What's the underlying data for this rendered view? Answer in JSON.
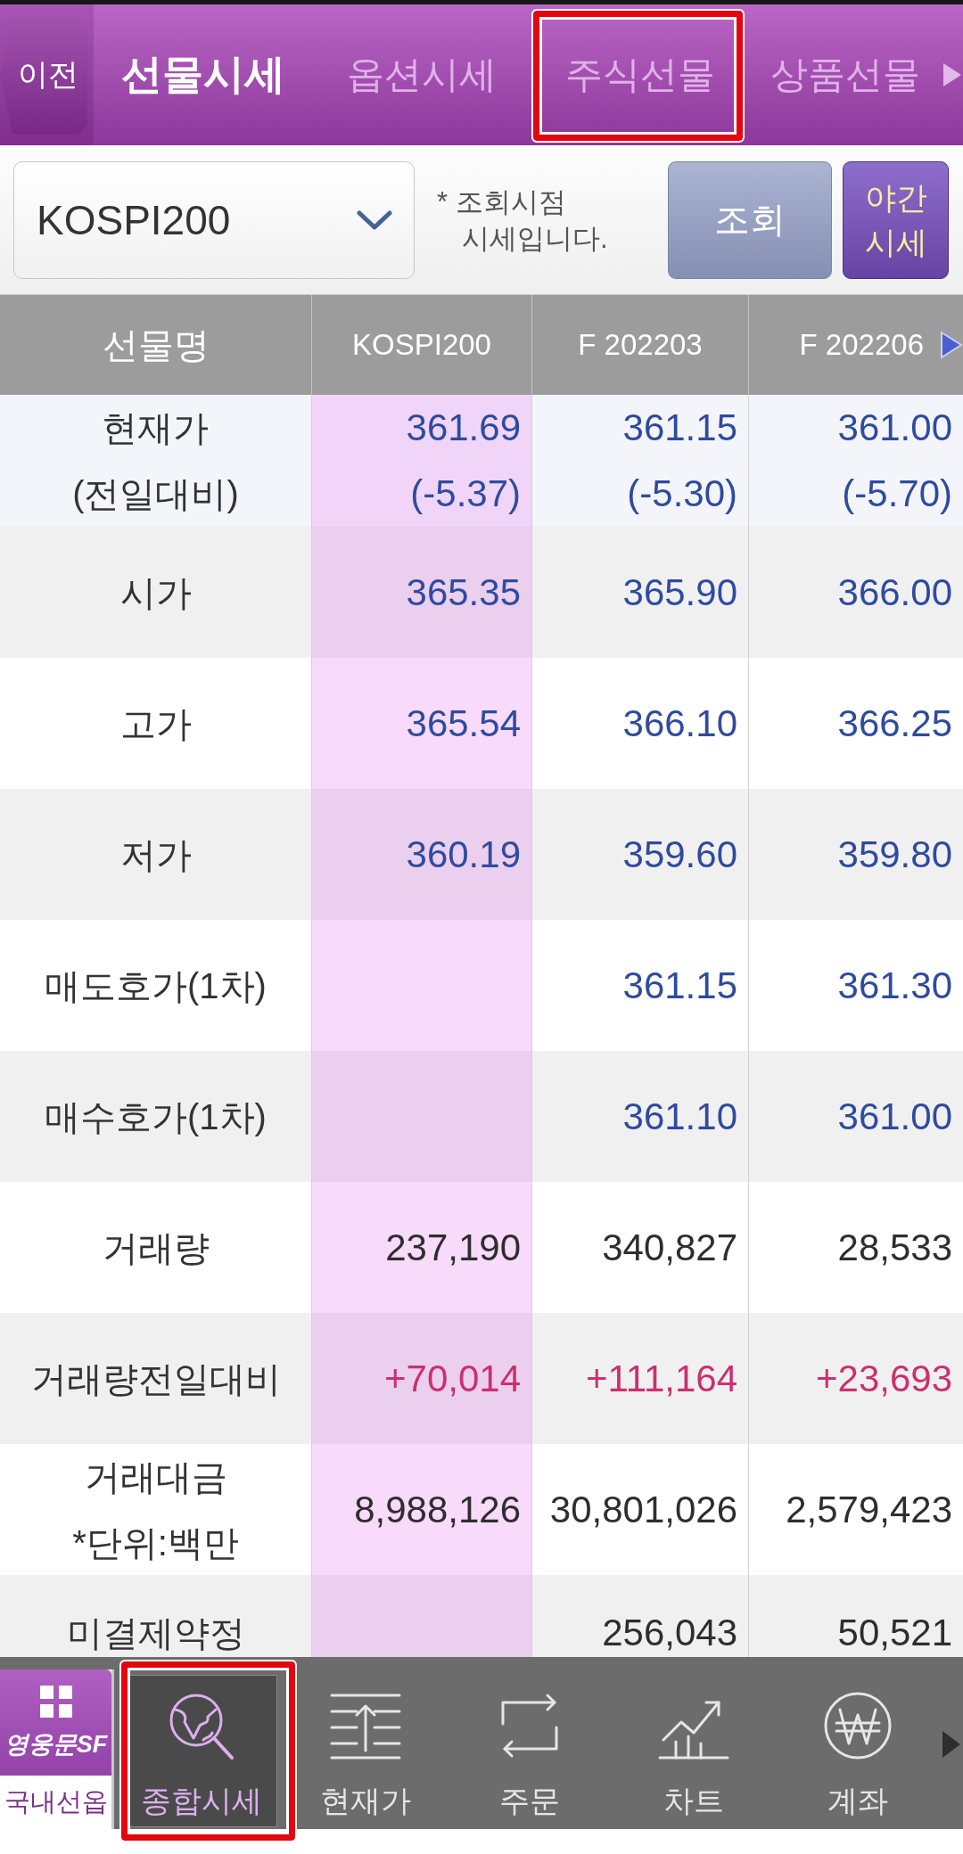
{
  "header": {
    "back_button": "이전",
    "tabs": [
      {
        "label": "선물시세",
        "selected": true,
        "highlighted": false
      },
      {
        "label": "옵션시세",
        "selected": false,
        "highlighted": false
      },
      {
        "label": "주식선물",
        "selected": false,
        "highlighted": true
      },
      {
        "label": "상품선물",
        "selected": false,
        "highlighted": false
      }
    ]
  },
  "toolbar": {
    "dropdown": {
      "value": "KOSPI200"
    },
    "note": "* 조회시점\n시세입니다.",
    "buttons": [
      {
        "kind": "query",
        "label": "조회"
      },
      {
        "kind": "night",
        "label": "야간\n시세"
      }
    ]
  },
  "table": {
    "columns": [
      {
        "label": "선물명",
        "selected": false
      },
      {
        "label": "KOSPI200",
        "selected": true
      },
      {
        "label": "F 202203",
        "selected": false
      },
      {
        "label": "F 202206",
        "selected": false
      }
    ],
    "rows": [
      {
        "kind": "price",
        "cells": [
          "현재가\n(전일대비)",
          "361.69\n(-5.37)",
          "361.15\n(-5.30)",
          "361.00\n(-5.70)"
        ]
      },
      {
        "kind": "price",
        "cells": [
          "시가",
          "365.35",
          "365.90",
          "366.00"
        ]
      },
      {
        "kind": "price",
        "cells": [
          "고가",
          "365.54",
          "366.10",
          "366.25"
        ]
      },
      {
        "kind": "price",
        "cells": [
          "저가",
          "360.19",
          "359.60",
          "359.80"
        ]
      },
      {
        "kind": "price",
        "cells": [
          "매도호가(1차)",
          "",
          "361.15",
          "361.30"
        ]
      },
      {
        "kind": "price",
        "cells": [
          "매수호가(1차)",
          "",
          "361.10",
          "361.00"
        ]
      },
      {
        "kind": "volume",
        "cells": [
          "거래량",
          "237,190",
          "340,827",
          "28,533"
        ]
      },
      {
        "kind": "change",
        "cells": [
          "거래량전일대비",
          "+70,014",
          "+111,164",
          "+23,693"
        ]
      },
      {
        "kind": "volume",
        "cells": [
          "거래대금\n*단위:백만",
          "8,988,126",
          "30,801,026",
          "2,579,423"
        ]
      },
      {
        "kind": "volume",
        "cells": [
          "미결제약정",
          "",
          "256,043",
          "50,521"
        ]
      }
    ]
  },
  "bottom_nav": {
    "app_tile": {
      "logo": "영웅문SF",
      "label": "국내선옵"
    },
    "items": [
      {
        "label": "종합시세",
        "selected": true,
        "highlighted": true
      },
      {
        "label": "현재가",
        "selected": false,
        "highlighted": false
      },
      {
        "label": "주문",
        "selected": false,
        "highlighted": false
      },
      {
        "label": "차트",
        "selected": false,
        "highlighted": false
      },
      {
        "label": "계좌",
        "selected": false,
        "highlighted": false
      }
    ]
  }
}
